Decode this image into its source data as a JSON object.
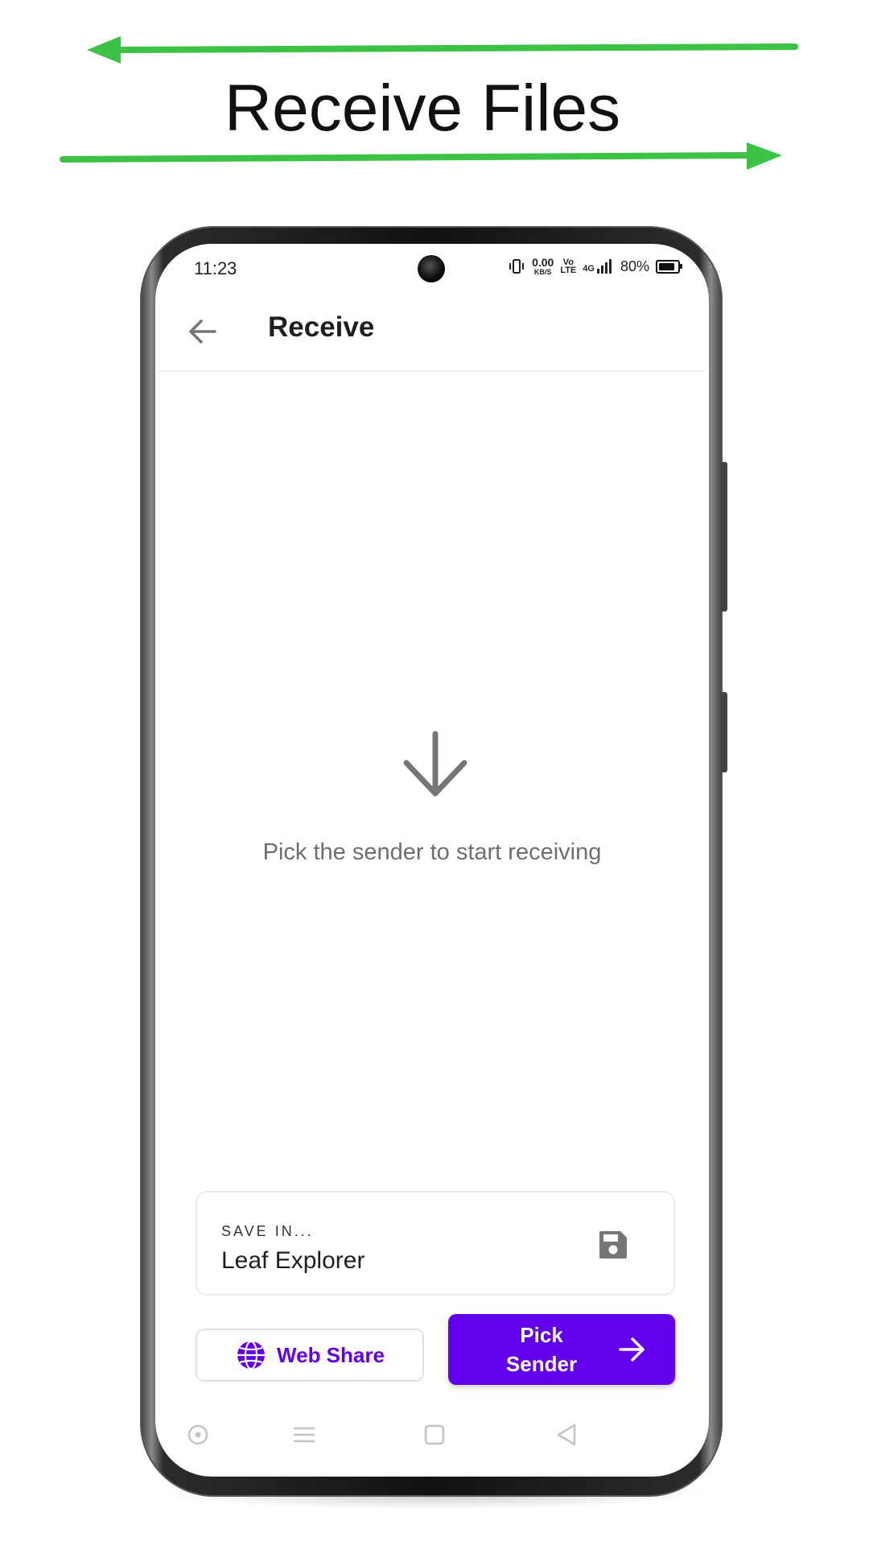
{
  "promo": {
    "title": "Receive Files",
    "arrow_color": "#3cc244"
  },
  "status_bar": {
    "time": "11:23",
    "data_rate_value": "0.00",
    "data_rate_unit": "KB/S",
    "volte_top": "Vo",
    "volte_bottom": "LTE",
    "network": "4G",
    "battery_percent": "80%"
  },
  "app_bar": {
    "title": "Receive",
    "back_icon": "arrow-left-icon"
  },
  "empty_state": {
    "icon": "arrow-down-icon",
    "message": "Pick the sender to start receiving"
  },
  "save_location": {
    "label": "SAVE IN...",
    "value": "Leaf Explorer",
    "icon": "floppy-disk-icon"
  },
  "actions": {
    "web_share_label": "Web Share",
    "web_share_icon": "globe-icon",
    "pick_sender_label_line1": "Pick",
    "pick_sender_label_line2": "Sender",
    "pick_sender_icon": "arrow-right-icon"
  },
  "nav_bar": {
    "items": [
      "target-icon",
      "menu-icon",
      "square-icon",
      "back-triangle-icon"
    ]
  },
  "colors": {
    "accent": "#6200ee",
    "icon_gray": "#757575",
    "text_secondary": "#6e6e6e"
  }
}
